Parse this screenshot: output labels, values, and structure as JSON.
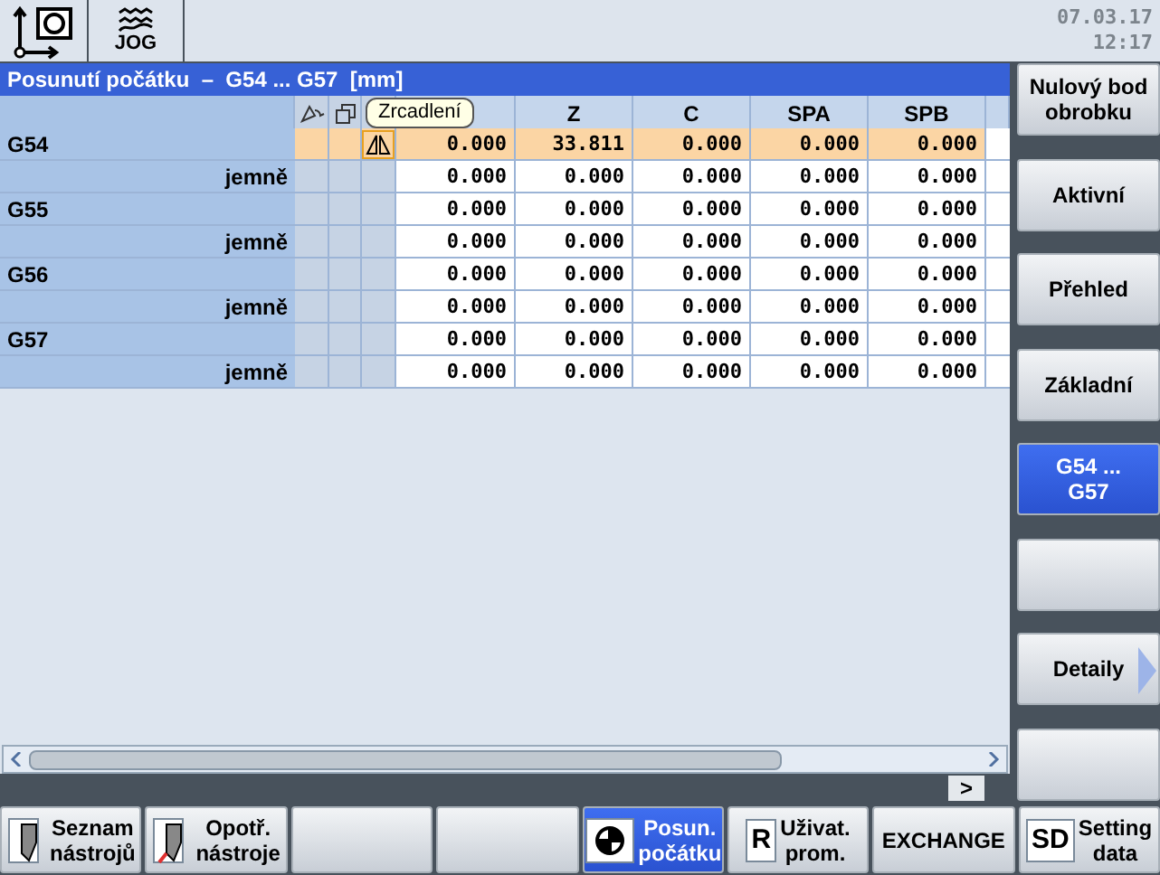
{
  "header": {
    "mode": "JOG",
    "date": "07.03.17",
    "time": "12:17"
  },
  "title": "Posunutí počátku  –  G54 ... G57  [mm]",
  "tooltip": "Zrcadlení",
  "table": {
    "columns": [
      "Z",
      "C",
      "SPA",
      "SPB"
    ],
    "rows": [
      {
        "label": "G54",
        "kind": "frame",
        "selected": true,
        "mirror": true,
        "values": [
          "0.000",
          "33.811",
          "0.000",
          "0.000",
          "0.000"
        ]
      },
      {
        "label": "jemně",
        "kind": "fine",
        "selected": false,
        "mirror": false,
        "values": [
          "0.000",
          "0.000",
          "0.000",
          "0.000",
          "0.000"
        ]
      },
      {
        "label": "G55",
        "kind": "frame",
        "selected": false,
        "mirror": false,
        "values": [
          "0.000",
          "0.000",
          "0.000",
          "0.000",
          "0.000"
        ]
      },
      {
        "label": "jemně",
        "kind": "fine",
        "selected": false,
        "mirror": false,
        "values": [
          "0.000",
          "0.000",
          "0.000",
          "0.000",
          "0.000"
        ]
      },
      {
        "label": "G56",
        "kind": "frame",
        "selected": false,
        "mirror": false,
        "values": [
          "0.000",
          "0.000",
          "0.000",
          "0.000",
          "0.000"
        ]
      },
      {
        "label": "jemně",
        "kind": "fine",
        "selected": false,
        "mirror": false,
        "values": [
          "0.000",
          "0.000",
          "0.000",
          "0.000",
          "0.000"
        ]
      },
      {
        "label": "G57",
        "kind": "frame",
        "selected": false,
        "mirror": false,
        "values": [
          "0.000",
          "0.000",
          "0.000",
          "0.000",
          "0.000"
        ]
      },
      {
        "label": "jemně",
        "kind": "fine",
        "selected": false,
        "mirror": false,
        "values": [
          "0.000",
          "0.000",
          "0.000",
          "0.000",
          "0.000"
        ]
      }
    ]
  },
  "next_button": ">",
  "right_softkeys": [
    {
      "lines": [
        "Nulový bod",
        "obrobku"
      ],
      "selected": false,
      "arrow": false
    },
    {
      "lines": [
        "Aktivní"
      ],
      "selected": false,
      "arrow": false
    },
    {
      "lines": [
        "Přehled"
      ],
      "selected": false,
      "arrow": false
    },
    {
      "lines": [
        "Základní"
      ],
      "selected": false,
      "arrow": false
    },
    {
      "lines": [
        "G54 ...",
        "G57"
      ],
      "selected": true,
      "arrow": false
    },
    {
      "selected": false,
      "arrow": false
    },
    {
      "lines": [
        "Detaily"
      ],
      "selected": false,
      "arrow": true
    },
    {
      "selected": false,
      "arrow": false
    }
  ],
  "bottom_softkeys": [
    {
      "lines": [
        "Seznam",
        "nástrojů"
      ],
      "kind": "tool",
      "selected": false
    },
    {
      "lines": [
        "Opotř.",
        "nástroje"
      ],
      "kind": "tool-wear",
      "selected": false
    },
    {
      "selected": false
    },
    {
      "selected": false
    },
    {
      "lines": [
        "Posun.",
        "počátku"
      ],
      "kind": "target",
      "selected": true
    },
    {
      "lines": [
        "Uživat.",
        "prom."
      ],
      "kind": "letter",
      "icon_text": "R",
      "selected": false
    },
    {
      "lines": [
        "EXCHANGE"
      ],
      "selected": false
    },
    {
      "lines": [
        "Setting",
        "data"
      ],
      "kind": "letter",
      "icon_text": "SD",
      "selected": false
    }
  ]
}
